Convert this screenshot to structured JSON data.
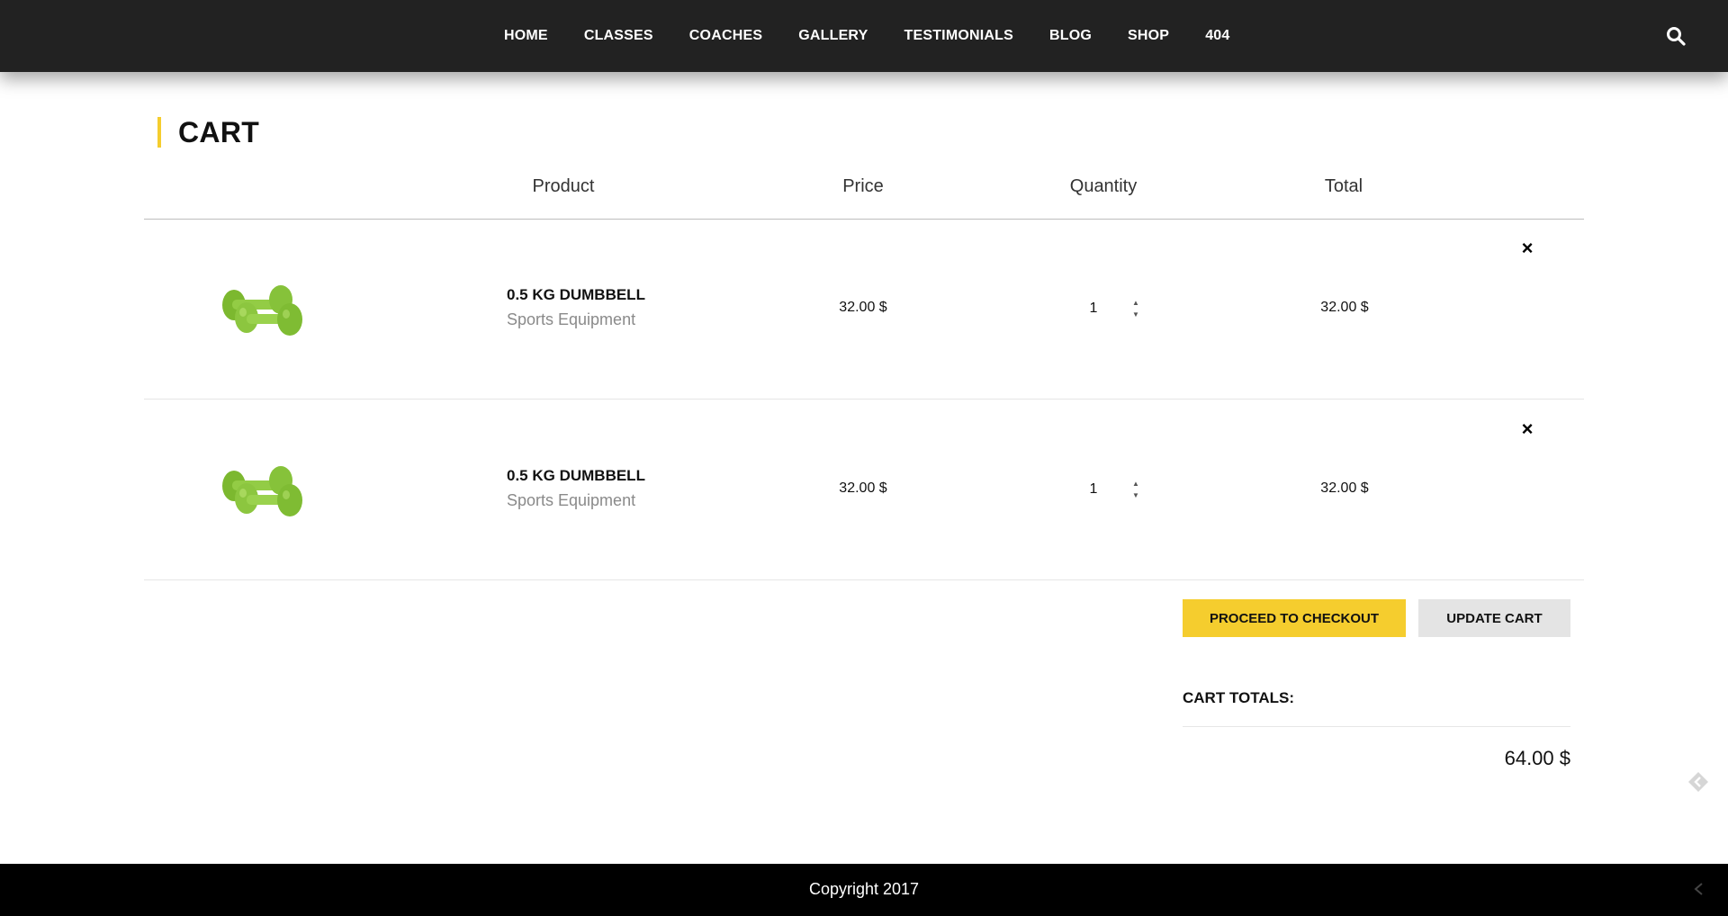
{
  "nav": {
    "items": [
      "HOME",
      "CLASSES",
      "COACHES",
      "GALLERY",
      "TESTIMONIALS",
      "BLOG",
      "SHOP",
      "404"
    ],
    "search_icon": "search-icon"
  },
  "page": {
    "title": "CART"
  },
  "table": {
    "headers": {
      "product": "Product",
      "price": "Price",
      "quantity": "Quantity",
      "total": "Total"
    },
    "rows": [
      {
        "name": "0.5 KG DUMBBELL",
        "category": "Sports Equipment",
        "price": "32.00 $",
        "quantity": "1",
        "total": "32.00 $",
        "remove": "×"
      },
      {
        "name": "0.5 KG DUMBBELL",
        "category": "Sports Equipment",
        "price": "32.00 $",
        "quantity": "1",
        "total": "32.00 $",
        "remove": "×"
      }
    ]
  },
  "actions": {
    "checkout": "PROCEED TO CHECKOUT",
    "update": "UPDATE CART"
  },
  "totals": {
    "title": "CART TOTALS:",
    "value": "64.00 $"
  },
  "footer": {
    "copyright": "Copyright 2017"
  },
  "colors": {
    "accent": "#f5cd2e",
    "header_bg": "#222222",
    "footer_bg": "#000000",
    "product_green": "#8cc63f"
  }
}
